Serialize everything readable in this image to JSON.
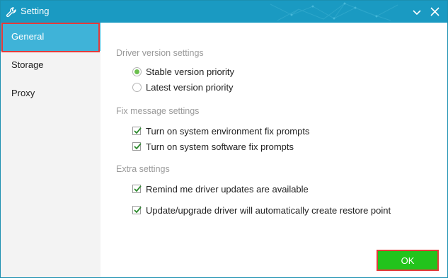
{
  "window": {
    "title": "Setting",
    "accent_color": "#1a9ac2",
    "icons": {
      "app": "wrench-icon",
      "minimize": "chevron-down-icon",
      "close": "close-icon"
    }
  },
  "sidebar": {
    "items": [
      {
        "label": "General",
        "active": true
      },
      {
        "label": "Storage",
        "active": false
      },
      {
        "label": "Proxy",
        "active": false
      }
    ]
  },
  "sections": {
    "driver_version": {
      "title": "Driver version settings",
      "options": [
        {
          "label": "Stable version priority",
          "selected": true
        },
        {
          "label": "Latest version priority",
          "selected": false
        }
      ]
    },
    "fix_message": {
      "title": "Fix message settings",
      "options": [
        {
          "label": "Turn on system environment fix prompts",
          "checked": true
        },
        {
          "label": "Turn on system software fix prompts",
          "checked": true
        }
      ]
    },
    "extra": {
      "title": "Extra settings",
      "options": [
        {
          "label": "Remind me driver updates are available",
          "checked": true
        },
        {
          "label": "Update/upgrade driver will automatically create restore point",
          "checked": true
        }
      ]
    }
  },
  "footer": {
    "ok_label": "OK",
    "ok_color": "#22c31c"
  }
}
